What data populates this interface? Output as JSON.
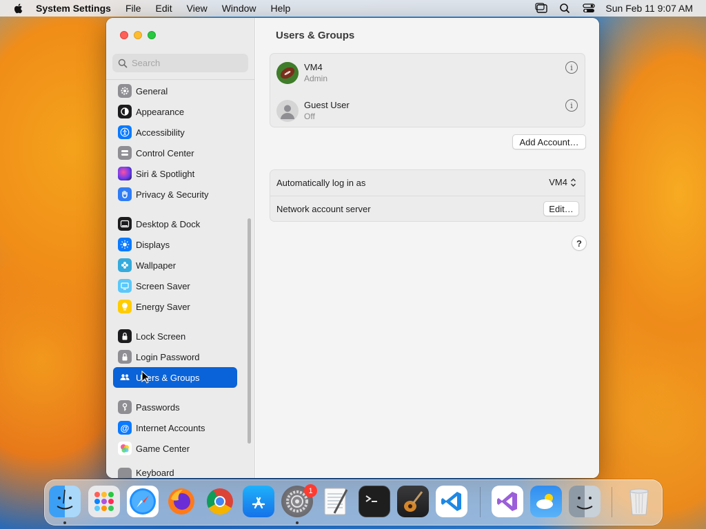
{
  "menubar": {
    "app_name": "System Settings",
    "menus": [
      "File",
      "Edit",
      "View",
      "Window",
      "Help"
    ],
    "clock": "Sun Feb 11  9:07 AM"
  },
  "sidebar": {
    "search_placeholder": "Search",
    "items": [
      {
        "label": "General",
        "icon": "gear-icon",
        "color": "#8e8e93"
      },
      {
        "label": "Appearance",
        "icon": "appearance-icon",
        "color": "#1c1c1e"
      },
      {
        "label": "Accessibility",
        "icon": "accessibility-icon",
        "color": "#0a7aff"
      },
      {
        "label": "Control Center",
        "icon": "control-center-icon",
        "color": "#8e8e93"
      },
      {
        "label": "Siri & Spotlight",
        "icon": "siri-icon",
        "color": "#7a3bd9"
      },
      {
        "label": "Privacy & Security",
        "icon": "hand-icon",
        "color": "#2f7cf6"
      },
      {
        "label": "Desktop & Dock",
        "icon": "dock-icon",
        "color": "#1c1c1e"
      },
      {
        "label": "Displays",
        "icon": "sun-icon",
        "color": "#0a7aff"
      },
      {
        "label": "Wallpaper",
        "icon": "wallpaper-icon",
        "color": "#35aadc"
      },
      {
        "label": "Screen Saver",
        "icon": "screen-saver-icon",
        "color": "#5ac8fa"
      },
      {
        "label": "Energy Saver",
        "icon": "lightbulb-icon",
        "color": "#ffcc00"
      },
      {
        "label": "Lock Screen",
        "icon": "lock-icon",
        "color": "#1c1c1e"
      },
      {
        "label": "Login Password",
        "icon": "padlock-icon",
        "color": "#8e8e93"
      },
      {
        "label": "Users & Groups",
        "icon": "users-icon",
        "color": "#0a63d8"
      },
      {
        "label": "Passwords",
        "icon": "key-icon",
        "color": "#8e8e93"
      },
      {
        "label": "Internet Accounts",
        "icon": "at-icon",
        "color": "#0a7aff"
      },
      {
        "label": "Game Center",
        "icon": "game-center-icon",
        "color": "#ffffff"
      },
      {
        "label": "Keyboard",
        "icon": "keyboard-icon",
        "color": "#8e8e93"
      }
    ],
    "selected": "Users & Groups"
  },
  "main": {
    "title": "Users & Groups",
    "users": [
      {
        "name": "VM4",
        "role": "Admin",
        "avatar": "football-avatar-icon"
      },
      {
        "name": "Guest User",
        "role": "Off",
        "avatar": "person-avatar-icon"
      }
    ],
    "add_account_label": "Add Account…",
    "auto_login_label": "Automatically log in as",
    "auto_login_value": "VM4",
    "network_server_label": "Network account server",
    "edit_label": "Edit…",
    "help_label": "?"
  },
  "dock": {
    "apps": [
      {
        "name": "Finder",
        "icon": "finder-icon",
        "running": true
      },
      {
        "name": "Launchpad",
        "icon": "launchpad-icon"
      },
      {
        "name": "Safari",
        "icon": "safari-icon"
      },
      {
        "name": "Firefox",
        "icon": "firefox-icon"
      },
      {
        "name": "Chrome",
        "icon": "chrome-icon"
      },
      {
        "name": "App Store",
        "icon": "app-store-icon"
      },
      {
        "name": "System Settings",
        "icon": "system-settings-icon",
        "running": true,
        "badge": "1"
      },
      {
        "name": "TextEdit",
        "icon": "textedit-icon"
      },
      {
        "name": "Terminal",
        "icon": "terminal-icon"
      },
      {
        "name": "GarageBand",
        "icon": "garageband-icon"
      },
      {
        "name": "VS Code",
        "icon": "vscode-icon"
      },
      {
        "name": "Visual Studio",
        "icon": "visual-studio-icon"
      },
      {
        "name": "Weather",
        "icon": "weather-icon"
      },
      {
        "name": "Finder 2",
        "icon": "finder-alt-icon"
      },
      {
        "name": "Trash",
        "icon": "trash-icon"
      }
    ]
  },
  "colors": {
    "accent": "#0a63d8",
    "window_bg": "#f4f4f4",
    "sidebar_bg": "#ebebeb"
  }
}
